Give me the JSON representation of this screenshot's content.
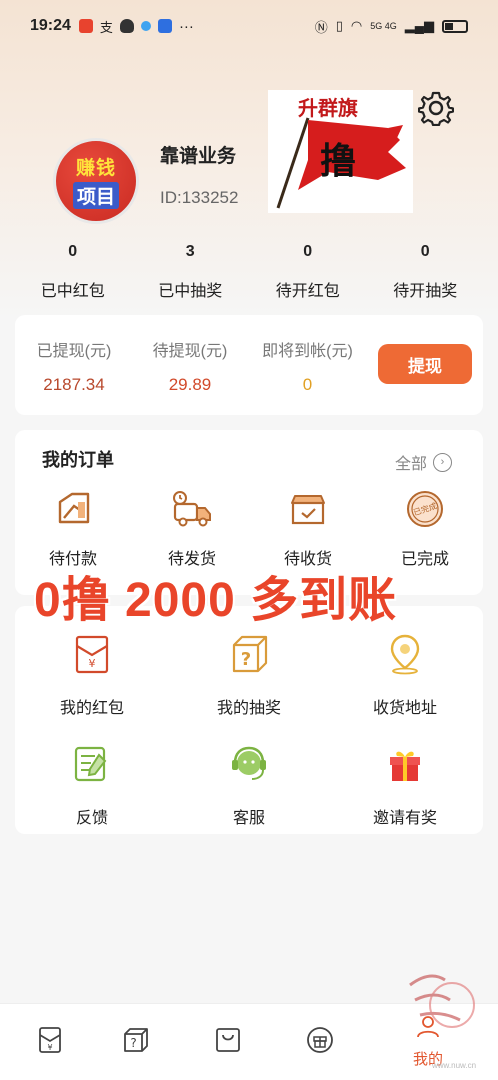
{
  "status_bar": {
    "time": "19:24",
    "extra": "···",
    "network": "5G 4G"
  },
  "profile": {
    "avatar_line1": "赚钱",
    "avatar_line2": "项目",
    "username": "靠谱业务",
    "user_id": "ID:133252",
    "flag_title": "升群旗",
    "flag_char": "撸"
  },
  "stats": [
    {
      "value": "0",
      "label": "已中红包"
    },
    {
      "value": "3",
      "label": "已中抽奖"
    },
    {
      "value": "0",
      "label": "待开红包"
    },
    {
      "value": "0",
      "label": "待开抽奖"
    }
  ],
  "wallet": {
    "withdrawn_label": "已提现(元)",
    "withdrawn_value": "2187.34",
    "pending_label": "待提现(元)",
    "pending_value": "29.89",
    "arriving_label": "即将到帐(元)",
    "arriving_value": "0",
    "withdraw_button": "提现",
    "colors": {
      "withdrawn": "#b8482c",
      "pending": "#d24a2b",
      "arriving": "#e1a024",
      "button": "#ee6a35"
    }
  },
  "orders": {
    "title": "我的订单",
    "all_label": "全部",
    "items": [
      {
        "label": "待付款",
        "icon": "payment-card-icon"
      },
      {
        "label": "待发货",
        "icon": "delivery-truck-icon"
      },
      {
        "label": "待收货",
        "icon": "package-box-icon"
      },
      {
        "label": "已完成",
        "icon": "completed-stamp-icon",
        "stamp_text": "已完成"
      }
    ]
  },
  "banner": "0撸 2000 多到账",
  "tools": [
    {
      "label": "我的红包",
      "icon": "red-envelope-icon"
    },
    {
      "label": "我的抽奖",
      "icon": "mystery-box-icon"
    },
    {
      "label": "收货地址",
      "icon": "location-pin-icon"
    },
    {
      "label": "反馈",
      "icon": "feedback-note-icon"
    },
    {
      "label": "客服",
      "icon": "customer-service-icon"
    },
    {
      "label": "邀请有奖",
      "icon": "gift-icon"
    }
  ],
  "tabbar": {
    "items": [
      {
        "icon": "red-envelope-tab-icon"
      },
      {
        "icon": "mystery-box-tab-icon"
      },
      {
        "icon": "shopping-bag-tab-icon"
      },
      {
        "icon": "gift-tab-icon"
      },
      {
        "icon": "profile-tab-icon",
        "label": "我的",
        "active": true
      }
    ]
  },
  "watermark": "www.nuw.cn"
}
